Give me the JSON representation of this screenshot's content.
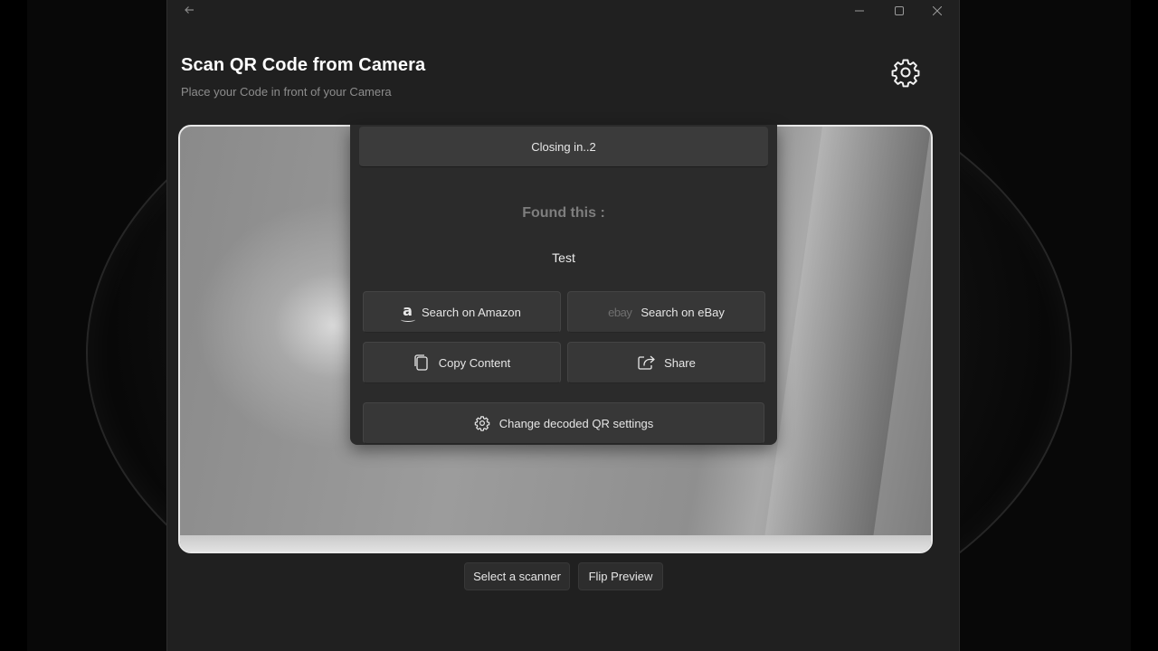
{
  "window": {
    "back_icon": "back-arrow-icon",
    "minimize_icon": "minimize-icon",
    "maximize_icon": "maximize-icon",
    "close_icon": "close-icon"
  },
  "header": {
    "title": "Scan QR Code from Camera",
    "subtitle": "Place your Code in front of your Camera",
    "settings_icon": "gear-icon"
  },
  "result": {
    "closing_text": "Closing in..2",
    "found_label": "Found this :",
    "found_value": "Test",
    "actions": {
      "amazon": {
        "label": "Search on Amazon",
        "icon": "amazon-icon",
        "glyph": "a"
      },
      "ebay": {
        "label": "Search on eBay",
        "icon": "ebay-icon",
        "glyph": "ebay"
      },
      "copy": {
        "label": "Copy Content",
        "icon": "copy-icon"
      },
      "share": {
        "label": "Share",
        "icon": "share-icon"
      },
      "settings": {
        "label": "Change decoded QR settings",
        "icon": "gear-icon"
      }
    }
  },
  "footer": {
    "select_scanner": "Select a scanner",
    "flip_preview": "Flip Preview"
  },
  "colors": {
    "window_bg": "#202020",
    "panel_bg": "#2b2b2b",
    "button_bg": "#373737",
    "text_primary": "#ffffff",
    "text_muted": "#8d8d8d"
  }
}
